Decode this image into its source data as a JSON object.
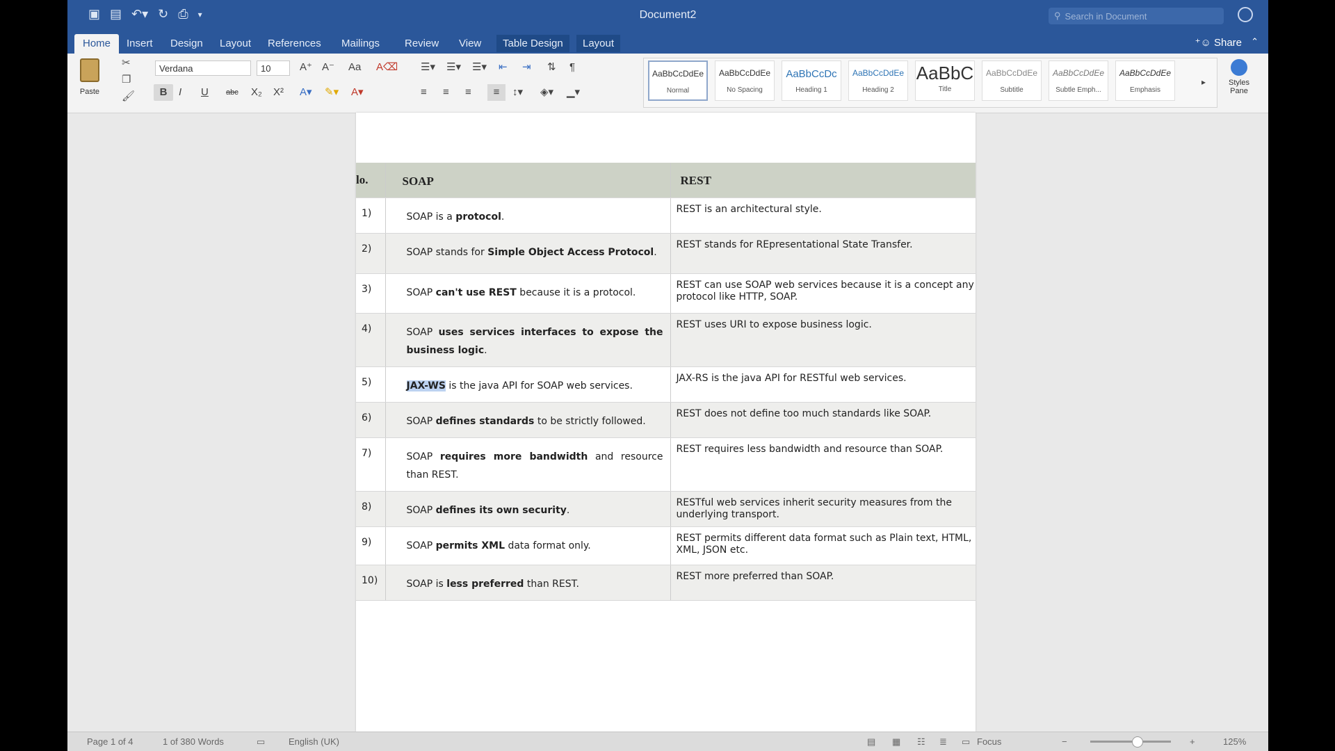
{
  "window": {
    "title": "Document2"
  },
  "search": {
    "placeholder": "Search in Document"
  },
  "tabs": [
    "Home",
    "Insert",
    "Design",
    "Layout",
    "References",
    "Mailings",
    "Review",
    "View",
    "Table Design",
    "Layout"
  ],
  "share_label": "Share",
  "ribbon": {
    "paste_label": "Paste",
    "font_name": "Verdana",
    "font_size": "10",
    "styles": [
      {
        "sample": "AaBbCcDdEe",
        "name": "Normal"
      },
      {
        "sample": "AaBbCcDdEe",
        "name": "No Spacing"
      },
      {
        "sample": "AaBbCcDc",
        "name": "Heading 1"
      },
      {
        "sample": "AaBbCcDdEe",
        "name": "Heading 2"
      },
      {
        "sample": "AaBbC",
        "name": "Title"
      },
      {
        "sample": "AaBbCcDdEe",
        "name": "Subtitle"
      },
      {
        "sample": "AaBbCcDdEe",
        "name": "Subtle Emph..."
      },
      {
        "sample": "AaBbCcDdEe",
        "name": "Emphasis"
      }
    ],
    "styles_pane_label": "Styles Pane"
  },
  "table": {
    "header": {
      "no": "lo.",
      "soap": "SOAP",
      "rest": "REST"
    },
    "rows": [
      {
        "no": "1)",
        "soap": [
          [
            "SOAP is a ",
            false
          ],
          [
            "protocol",
            true
          ],
          [
            ".",
            false
          ]
        ],
        "rest": "REST is an architectural style."
      },
      {
        "no": "2)",
        "soap": [
          [
            "SOAP stands for ",
            false
          ],
          [
            "Simple Object Access Protocol",
            true
          ],
          [
            ".",
            false
          ]
        ],
        "rest": "REST stands for REpresentational State Transfer."
      },
      {
        "no": "3)",
        "soap": [
          [
            "SOAP ",
            false
          ],
          [
            "can't use REST",
            true
          ],
          [
            " because it is a protocol.",
            false
          ]
        ],
        "rest": "REST can use SOAP web services because it is a concept any protocol like HTTP, SOAP."
      },
      {
        "no": "4)",
        "soap": [
          [
            "SOAP ",
            false
          ],
          [
            "uses services interfaces to expose the business logic",
            true
          ],
          [
            ".",
            false
          ]
        ],
        "rest": "REST uses URI to expose business logic."
      },
      {
        "no": "5)",
        "soap": [
          [
            "JAX-WS",
            true
          ],
          [
            " is the java API for SOAP web services.",
            false
          ]
        ],
        "rest": "JAX-RS is the java API for RESTful web services."
      },
      {
        "no": "6)",
        "soap": [
          [
            "SOAP ",
            false
          ],
          [
            "defines standards",
            true
          ],
          [
            " to be strictly followed.",
            false
          ]
        ],
        "rest": "REST does not define too much standards like SOAP."
      },
      {
        "no": "7)",
        "soap": [
          [
            "SOAP ",
            false
          ],
          [
            "requires more bandwidth",
            true
          ],
          [
            " and resource than REST.",
            false
          ]
        ],
        "rest": "REST requires less bandwidth and resource than SOAP."
      },
      {
        "no": "8)",
        "soap": [
          [
            "SOAP ",
            false
          ],
          [
            "defines its own security",
            true
          ],
          [
            ".",
            false
          ]
        ],
        "rest": "RESTful web services inherit security measures from the underlying transport."
      },
      {
        "no": "9)",
        "soap": [
          [
            "SOAP ",
            false
          ],
          [
            "permits XML",
            true
          ],
          [
            " data format only.",
            false
          ]
        ],
        "rest": "REST permits different data format such as Plain text, HTML, XML, JSON etc."
      },
      {
        "no": "10)",
        "soap": [
          [
            "SOAP is ",
            false
          ],
          [
            "less preferred",
            true
          ],
          [
            " than REST.",
            false
          ]
        ],
        "rest": "REST more preferred than SOAP."
      }
    ]
  },
  "status": {
    "page": "Page 1 of 4",
    "words": "1 of 380 Words",
    "language": "English (UK)",
    "focus": "Focus",
    "zoom": "125%"
  }
}
